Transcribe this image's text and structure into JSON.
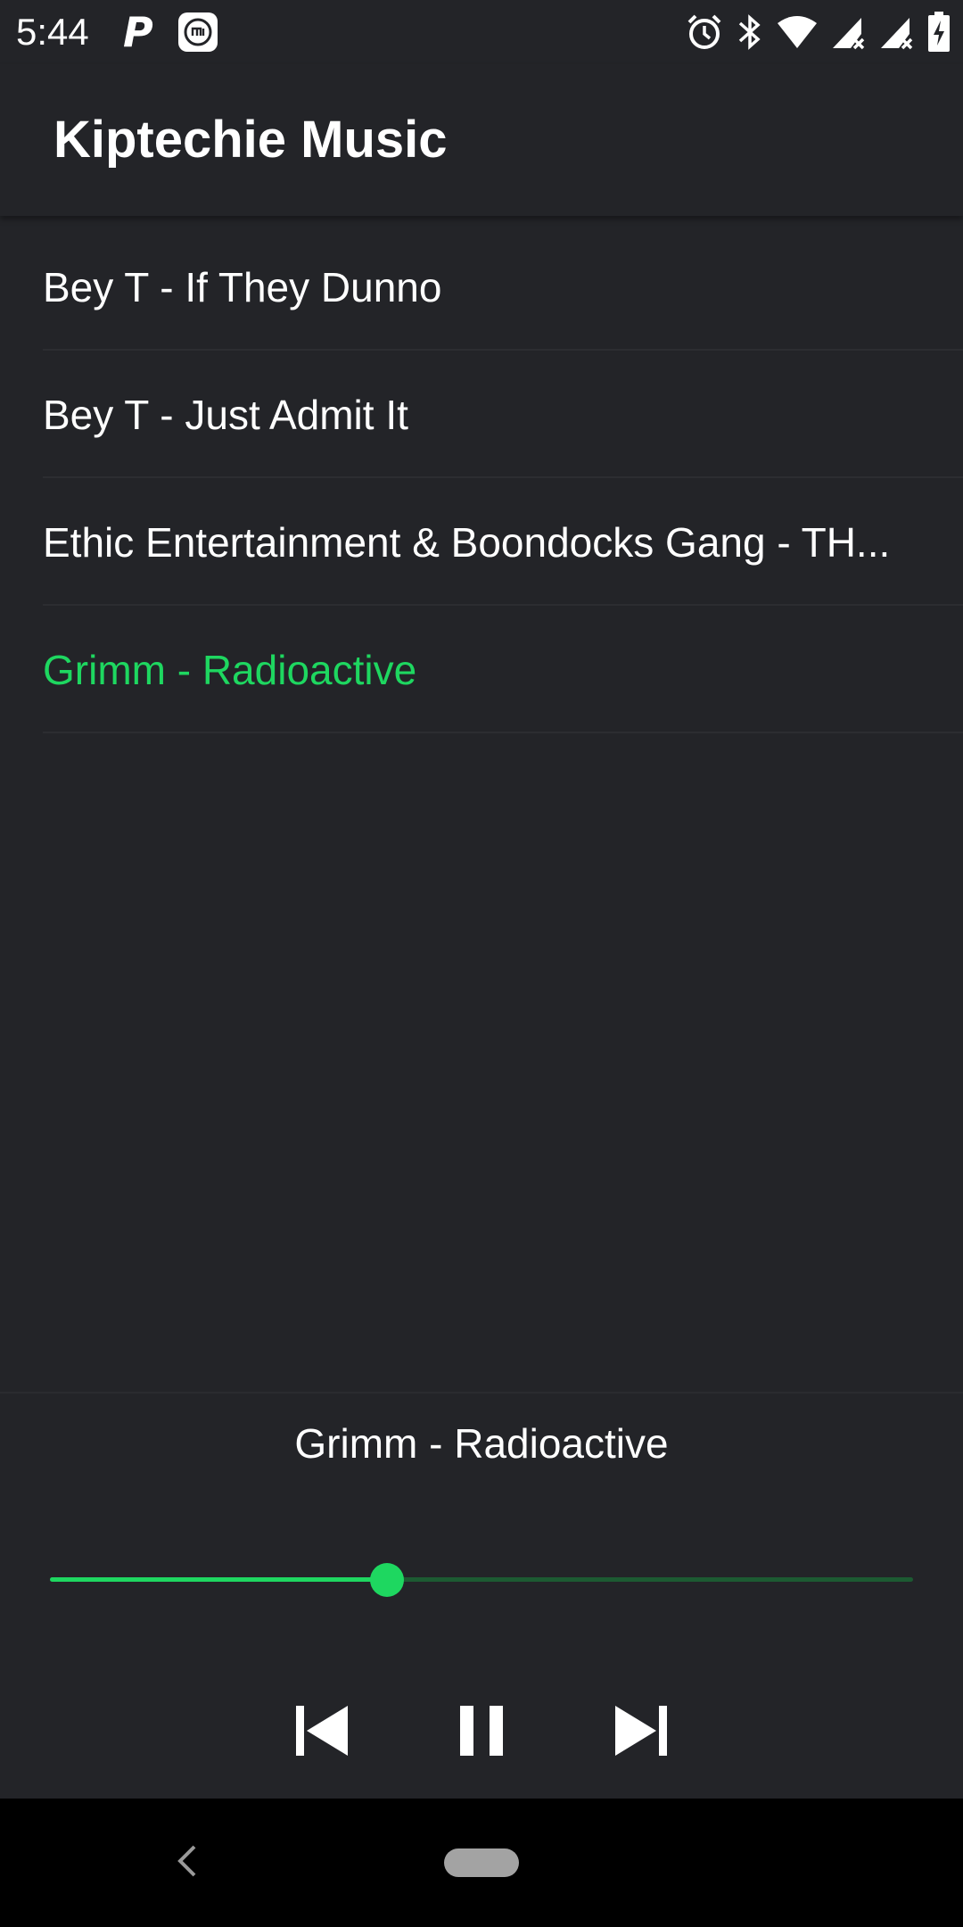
{
  "status_bar": {
    "time": "5:44",
    "left_icons": [
      "parking-icon",
      "mi-icon"
    ],
    "right_icons": [
      "alarm-icon",
      "bluetooth-icon",
      "wifi-icon",
      "signal-icon",
      "signal-icon",
      "battery-icon"
    ]
  },
  "app_bar": {
    "title": "Kiptechie Music"
  },
  "songs": [
    {
      "title": "Bey T - If They Dunno",
      "active": false
    },
    {
      "title": "Bey T - Just Admit It",
      "active": false
    },
    {
      "title": "Ethic Entertainment & Boondocks Gang - TH...",
      "active": false
    },
    {
      "title": "Grimm - Radioactive",
      "active": true
    }
  ],
  "player": {
    "now_playing": "Grimm - Radioactive",
    "progress_fraction": 0.39,
    "controls": [
      "skip-previous-icon",
      "pause-icon",
      "skip-next-icon"
    ]
  },
  "colors": {
    "background": "#232428",
    "accent": "#1ed760",
    "track": "#1c5a32",
    "text": "#ffffff"
  }
}
